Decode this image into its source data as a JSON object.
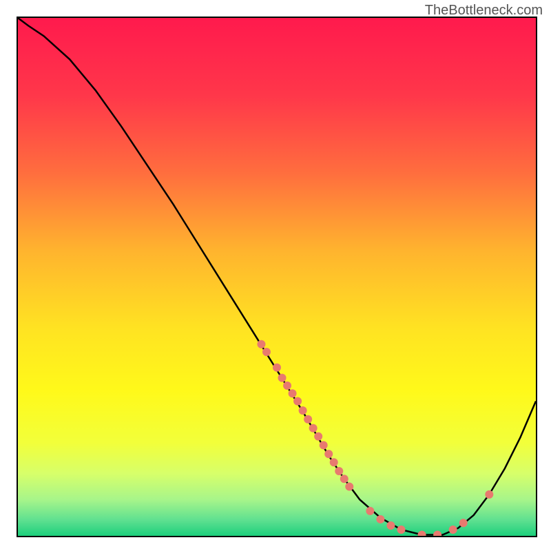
{
  "watermark": "TheBottleneck.com",
  "chart_data": {
    "type": "line",
    "title": "",
    "xlabel": "",
    "ylabel": "",
    "xlim": [
      0,
      100
    ],
    "ylim": [
      0,
      100
    ],
    "series": [
      {
        "name": "curve",
        "x": [
          0,
          2,
          5,
          10,
          15,
          20,
          25,
          30,
          35,
          40,
          45,
          50,
          55,
          60,
          63,
          66,
          70,
          74,
          78,
          82,
          85,
          88,
          91,
          94,
          97,
          100
        ],
        "y": [
          100,
          98.5,
          96.5,
          92,
          86,
          79,
          71.5,
          64,
          56,
          48,
          40,
          32,
          24,
          15.5,
          11,
          7,
          3.5,
          1.2,
          0.2,
          0.2,
          1.5,
          4,
          8,
          13,
          19,
          26
        ]
      }
    ],
    "scatter_points": {
      "on_descending": [
        {
          "x": 47,
          "y": 37
        },
        {
          "x": 48,
          "y": 35.5
        },
        {
          "x": 50,
          "y": 32.5
        },
        {
          "x": 51,
          "y": 30.5
        },
        {
          "x": 52,
          "y": 29
        },
        {
          "x": 53,
          "y": 27.5
        },
        {
          "x": 54,
          "y": 26
        },
        {
          "x": 55,
          "y": 24.2
        },
        {
          "x": 56,
          "y": 22.5
        },
        {
          "x": 57,
          "y": 20.8
        },
        {
          "x": 58,
          "y": 19.2
        },
        {
          "x": 59,
          "y": 17.5
        },
        {
          "x": 60,
          "y": 15.8
        },
        {
          "x": 61,
          "y": 14.2
        },
        {
          "x": 62,
          "y": 12.5
        },
        {
          "x": 63,
          "y": 11
        },
        {
          "x": 64,
          "y": 9.5
        }
      ],
      "on_trough": [
        {
          "x": 68,
          "y": 4.8
        },
        {
          "x": 70,
          "y": 3.2
        },
        {
          "x": 72,
          "y": 2
        },
        {
          "x": 74,
          "y": 1.2
        },
        {
          "x": 78,
          "y": 0.2
        },
        {
          "x": 81,
          "y": 0.2
        },
        {
          "x": 84,
          "y": 1.2
        },
        {
          "x": 86,
          "y": 2.5
        }
      ],
      "on_ascending": [
        {
          "x": 91,
          "y": 8
        }
      ]
    },
    "gradient_stops": [
      {
        "offset": 0.0,
        "color": "#ff1a4d"
      },
      {
        "offset": 0.15,
        "color": "#ff374a"
      },
      {
        "offset": 0.3,
        "color": "#ff6e3e"
      },
      {
        "offset": 0.45,
        "color": "#ffb42e"
      },
      {
        "offset": 0.6,
        "color": "#ffe322"
      },
      {
        "offset": 0.72,
        "color": "#fff91a"
      },
      {
        "offset": 0.82,
        "color": "#f2ff3a"
      },
      {
        "offset": 0.88,
        "color": "#d7ff6a"
      },
      {
        "offset": 0.93,
        "color": "#a7f58a"
      },
      {
        "offset": 0.97,
        "color": "#5ee090"
      },
      {
        "offset": 1.0,
        "color": "#1ccf7c"
      }
    ],
    "point_style": {
      "fill": "#e87a6f",
      "radius": 6
    }
  }
}
